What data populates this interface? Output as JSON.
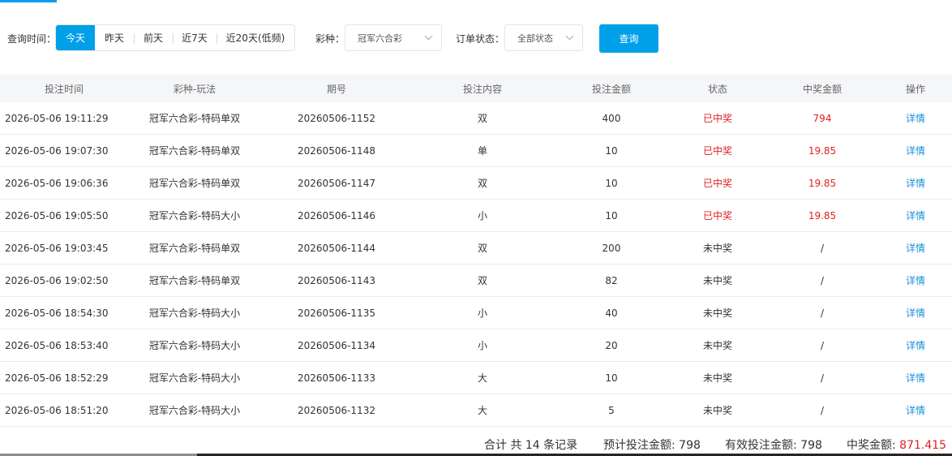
{
  "filters": {
    "time_label": "查询时间：",
    "time_options": [
      "今天",
      "昨天",
      "前天",
      "近7天",
      "近20天(低频)"
    ],
    "lottery_label": "彩种：",
    "lottery_value": "冠军六合彩",
    "status_label": "订单状态：",
    "status_value": "全部状态",
    "query_button": "查询"
  },
  "table": {
    "headers": [
      "投注时间",
      "彩种-玩法",
      "期号",
      "投注内容",
      "投注金额",
      "状态",
      "中奖金额",
      "操作"
    ],
    "rows": [
      [
        "2026-05-06 19:11:29",
        "冠军六合彩-特码单双",
        "20260506-1152",
        "双",
        "400",
        "已中奖",
        "794",
        "详情"
      ],
      [
        "2026-05-06 19:07:30",
        "冠军六合彩-特码单双",
        "20260506-1148",
        "单",
        "10",
        "已中奖",
        "19.85",
        "详情"
      ],
      [
        "2026-05-06 19:06:36",
        "冠军六合彩-特码单双",
        "20260506-1147",
        "双",
        "10",
        "已中奖",
        "19.85",
        "详情"
      ],
      [
        "2026-05-06 19:05:50",
        "冠军六合彩-特码大小",
        "20260506-1146",
        "小",
        "10",
        "已中奖",
        "19.85",
        "详情"
      ],
      [
        "2026-05-06 19:03:45",
        "冠军六合彩-特码单双",
        "20260506-1144",
        "双",
        "200",
        "未中奖",
        "/",
        "详情"
      ],
      [
        "2026-05-06 19:02:50",
        "冠军六合彩-特码单双",
        "20260506-1143",
        "双",
        "82",
        "未中奖",
        "/",
        "详情"
      ],
      [
        "2026-05-06 18:54:30",
        "冠军六合彩-特码大小",
        "20260506-1135",
        "小",
        "40",
        "未中奖",
        "/",
        "详情"
      ],
      [
        "2026-05-06 18:53:40",
        "冠军六合彩-特码大小",
        "20260506-1134",
        "小",
        "20",
        "未中奖",
        "/",
        "详情"
      ],
      [
        "2026-05-06 18:52:29",
        "冠军六合彩-特码大小",
        "20260506-1133",
        "大",
        "10",
        "未中奖",
        "/",
        "详情"
      ],
      [
        "2026-05-06 18:51:20",
        "冠军六合彩-特码大小",
        "20260506-1132",
        "大",
        "5",
        "未中奖",
        "/",
        "详情"
      ]
    ]
  },
  "summary": {
    "total_records": "合计 共 14 条记录",
    "planned_label": "预计投注金额: ",
    "planned_value": "798",
    "effective_label": "有效投注金额: ",
    "effective_value": "798",
    "win_label": "中奖金额: ",
    "win_value": "871.415"
  },
  "colors": {
    "accent": "#00a0e9",
    "win": "#e02121",
    "link": "#1a8fd8"
  }
}
